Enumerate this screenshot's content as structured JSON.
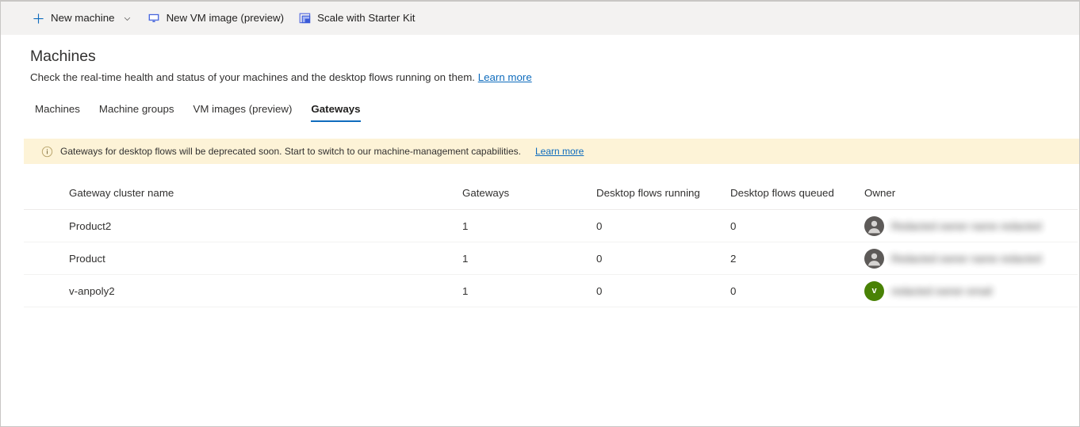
{
  "commandbar": {
    "items": [
      {
        "label": "New machine",
        "icon": "plus-icon",
        "has_chevron": true
      },
      {
        "label": "New VM image (preview)",
        "icon": "monitor-icon",
        "has_chevron": false
      },
      {
        "label": "Scale with Starter Kit",
        "icon": "scale-starter-kit-icon",
        "has_chevron": false
      }
    ]
  },
  "page": {
    "title": "Machines",
    "subtitle": "Check the real-time health and status of your machines and the desktop flows running on them.",
    "subtitle_link": "Learn more"
  },
  "tabs": [
    {
      "label": "Machines",
      "selected": false
    },
    {
      "label": "Machine groups",
      "selected": false
    },
    {
      "label": "VM images (preview)",
      "selected": false
    },
    {
      "label": "Gateways",
      "selected": true
    }
  ],
  "message_bar": {
    "icon": "info-icon",
    "text": "Gateways for desktop flows will be deprecated soon. Start to switch to our machine-management capabilities.",
    "link": "Learn more"
  },
  "table": {
    "columns": [
      "Gateway cluster name",
      "Gateways",
      "Desktop flows running",
      "Desktop flows queued",
      "Owner"
    ],
    "rows": [
      {
        "name": "Product2",
        "gateways": "1",
        "running": "0",
        "queued": "0",
        "owner": {
          "avatar_type": "person",
          "avatar_initial": "",
          "name": "Redacted owner name redacted"
        }
      },
      {
        "name": "Product",
        "gateways": "1",
        "running": "0",
        "queued": "2",
        "owner": {
          "avatar_type": "person",
          "avatar_initial": "",
          "name": "Redacted owner name redacted"
        }
      },
      {
        "name": "v-anpoly2",
        "gateways": "1",
        "running": "0",
        "queued": "0",
        "owner": {
          "avatar_type": "initial",
          "avatar_initial": "v",
          "name": "redacted owner email"
        }
      }
    ]
  },
  "colors": {
    "accent": "#0f6cbd",
    "commandbar_bg": "#f3f2f1",
    "messagebar_bg": "#fdf3d7",
    "avatar_person": "#5d5a58",
    "avatar_initial": "#498205"
  }
}
